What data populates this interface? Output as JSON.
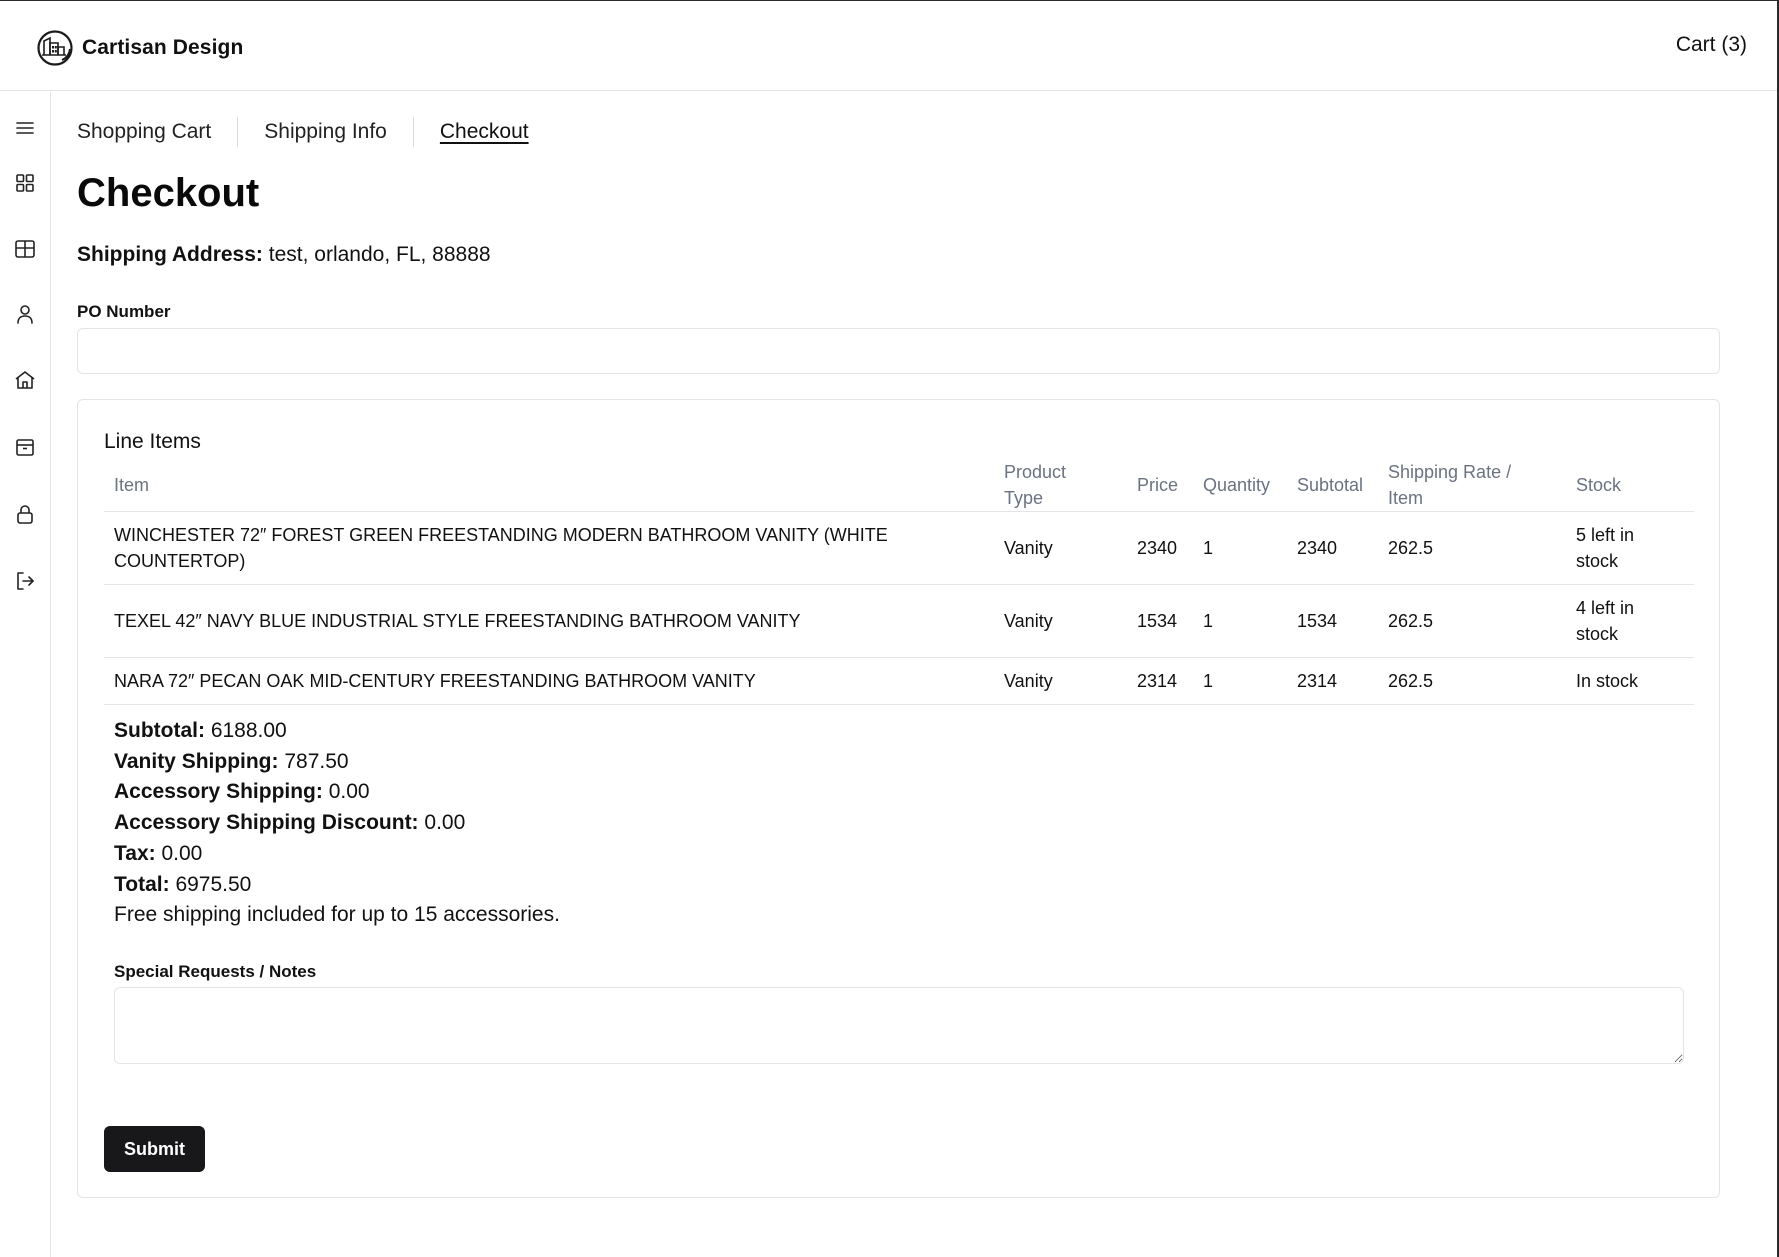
{
  "header": {
    "brand_name": "Cartisan Design",
    "cart_label": "Cart (3)"
  },
  "sidebar": {
    "icons": [
      "menu-icon",
      "dashboard-grid-icon",
      "table-icon",
      "user-icon",
      "home-icon",
      "package-icon",
      "lock-icon",
      "logout-icon"
    ]
  },
  "tabs": [
    {
      "label": "Shopping Cart",
      "active": false
    },
    {
      "label": "Shipping Info",
      "active": false
    },
    {
      "label": "Checkout",
      "active": true
    }
  ],
  "page": {
    "title": "Checkout",
    "shipping_address_label": "Shipping Address:",
    "shipping_address_value": "test, orlando, FL, 88888",
    "po_label": "PO Number",
    "po_value": ""
  },
  "line_items": {
    "title": "Line Items",
    "columns": {
      "item": "Item",
      "type_1": "Product",
      "type_2": "Type",
      "price": "Price",
      "quantity": "Quantity",
      "subtotal": "Subtotal",
      "rate_1": "Shipping Rate /",
      "rate_2": "Item",
      "stock": "Stock"
    },
    "rows": [
      {
        "item_1": "WINCHESTER 72″ FOREST GREEN FREESTANDING MODERN BATHROOM VANITY (WHITE",
        "item_2": "COUNTERTOP)",
        "type": "Vanity",
        "price": "2340",
        "quantity": "1",
        "subtotal": "2340",
        "rate": "262.5",
        "stock_1": "5 left in",
        "stock_2": "stock"
      },
      {
        "item_1": "TEXEL 42″ NAVY BLUE INDUSTRIAL STYLE FREESTANDING BATHROOM VANITY",
        "type": "Vanity",
        "price": "1534",
        "quantity": "1",
        "subtotal": "1534",
        "rate": "262.5",
        "stock_1": "4 left in",
        "stock_2": "stock"
      },
      {
        "item_1": "NARA 72″ PECAN OAK MID-CENTURY FREESTANDING BATHROOM VANITY",
        "type": "Vanity",
        "price": "2314",
        "quantity": "1",
        "subtotal": "2314",
        "rate": "262.5",
        "stock_1": "In stock"
      }
    ]
  },
  "totals": {
    "subtotal_label": "Subtotal:",
    "subtotal_value": "6188.00",
    "vanity_shipping_label": "Vanity Shipping:",
    "vanity_shipping_value": "787.50",
    "accessory_shipping_label": "Accessory Shipping:",
    "accessory_shipping_value": "0.00",
    "accessory_discount_label": "Accessory Shipping Discount:",
    "accessory_discount_value": "0.00",
    "tax_label": "Tax:",
    "tax_value": "0.00",
    "total_label": "Total:",
    "total_value": "6975.50",
    "note": "Free shipping included for up to 15 accessories."
  },
  "notes": {
    "label": "Special Requests / Notes",
    "value": ""
  },
  "submit_label": "Submit",
  "colors": {
    "stock_low": "#ef4444",
    "button_bg": "#18181b",
    "border": "#e4e4e7",
    "muted_text": "#6b7280"
  }
}
